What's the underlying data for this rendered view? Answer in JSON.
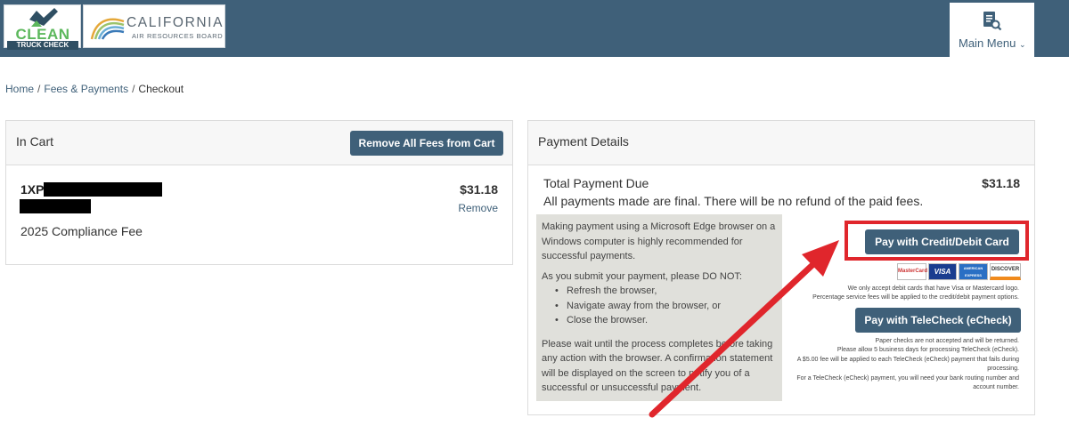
{
  "header": {
    "logo_ctc": {
      "line1": "CLEAN",
      "line2": "TRUCK CHECK"
    },
    "logo_carb": {
      "title": "CALIFORNIA",
      "subtitle": "AIR RESOURCES BOARD"
    },
    "main_menu_label": "Main Menu",
    "menu_chevron": "⌄"
  },
  "breadcrumb": {
    "items": [
      "Home",
      "Fees & Payments",
      "Checkout"
    ],
    "separator": "/"
  },
  "cart": {
    "title": "In Cart",
    "remove_all_label": "Remove All Fees from Cart",
    "item": {
      "id_prefix": "1XP",
      "fee_name": "2025 Compliance Fee",
      "amount": "$31.18",
      "remove_label": "Remove"
    }
  },
  "payment": {
    "title": "Payment Details",
    "total_label": "Total Payment Due",
    "total_amount": "$31.18",
    "final_notice": "All payments made are final. There will be no refund of the paid fees.",
    "browser_notice": "Making payment using a Microsoft Edge browser on a Windows computer is highly recommended for successful payments.",
    "do_not_intro": "As you submit your payment, please DO NOT:",
    "do_not_items": [
      "Refresh the browser,",
      "Navigate away from the browser, or",
      "Close the browser."
    ],
    "wait_notice": "Please wait until the process completes before taking any action with the browser. A confirmation statement will be displayed on the screen to notify you of a successful or unsuccessful payment.",
    "credit_button_label": "Pay with Credit/Debit Card",
    "card_logos": [
      "MasterCard",
      "VISA",
      "AMERICAN EXPRESS",
      "DISCOVER"
    ],
    "card_fine_1": "We only accept debit cards that have Visa or Mastercard logo.",
    "card_fine_2": "Percentage service fees will be applied to the credit/debit payment options.",
    "echeck_button_label": "Pay with TeleCheck (eCheck)",
    "echeck_fine_1": "Paper checks are not accepted and will be returned.",
    "echeck_fine_2": "Please allow 5 business days for processing TeleCheck (eCheck).",
    "echeck_fine_3": "A $5.00 fee will be applied to each TeleCheck (eCheck) payment that fails during",
    "echeck_fine_4": "processing.",
    "echeck_fine_5": "For a TeleCheck (eCheck) payment, you will need your bank routing number and",
    "echeck_fine_6": "account number."
  },
  "colors": {
    "header": "#3f6079",
    "button": "#3f6079",
    "highlight": "#e0262c",
    "notice_bg": "#e0e0db",
    "brand_green": "#5cb85c"
  },
  "icons": [
    "clean-truck-check-logo",
    "carb-logo",
    "document-search-icon",
    "chevron-down-icon",
    "red-arrow-annotation"
  ]
}
